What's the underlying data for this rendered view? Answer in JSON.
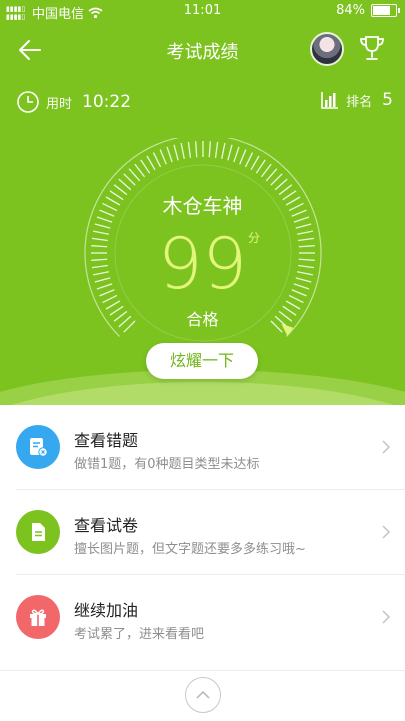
{
  "status_bar": {
    "carrier": "中国电信",
    "time": "11:01",
    "battery": "84%",
    "battery_level": 0.84
  },
  "nav": {
    "title": "考试成绩",
    "back_icon": "back-arrow-icon",
    "trophy_icon": "trophy-icon"
  },
  "stats": {
    "time_label": "用时",
    "time_value": "10:22",
    "rank_label": "排名",
    "rank_value": "5"
  },
  "score": {
    "name": "木仓车神",
    "value": "99",
    "unit": "分",
    "status": "合格",
    "fraction": 0.99
  },
  "share_button": "炫耀一下",
  "items": [
    {
      "title": "查看错题",
      "subtitle": "做错1题，有0种题目类型未达标",
      "icon": "wrong-questions-icon",
      "color": "#35a8f0"
    },
    {
      "title": "查看试卷",
      "subtitle": "擅长图片题，但文字题还要多多练习哦~",
      "icon": "document-icon",
      "color": "#7cc320"
    },
    {
      "title": "继续加油",
      "subtitle": "考试累了，进来看看吧",
      "icon": "gift-icon",
      "color": "#f2686a"
    }
  ],
  "footer": {
    "icon": "chevron-up-icon"
  }
}
